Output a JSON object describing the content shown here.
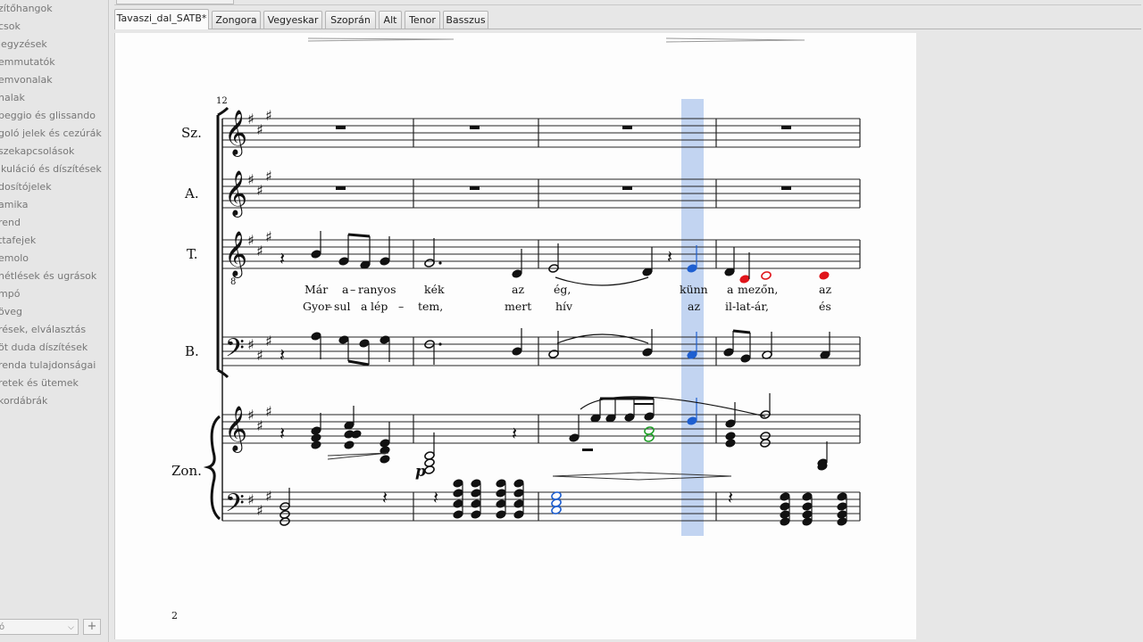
{
  "palette": {
    "items": [
      "zítőhangok",
      "csok",
      "jegyzések",
      "emmutatók",
      "emvonalak",
      "nalak",
      "peggio és glissando",
      "goló jelek és cezúrák",
      "szekapcsolások",
      "ikuláció és díszítések",
      "dosítójelek",
      "amika",
      "rend",
      "ttafejek",
      "emolo",
      "nétlések és ugrások",
      "mpó",
      "öveg",
      "rések, elválasztás",
      "öt duda díszítések",
      "renda tulajdonságai",
      "retek és ütemek",
      "kordábrák"
    ],
    "selector_value": "ó",
    "selector_arrow": "⌵",
    "add_label": "+"
  },
  "tabs": [
    "Tavaszi_dal_SATB*",
    "Zongora",
    "Vegyeskar",
    "Szoprán",
    "Alt",
    "Tenor",
    "Basszus"
  ],
  "score": {
    "measure_number": "12",
    "page_number": "2",
    "staff_names": [
      "Sz.",
      "A.",
      "T.",
      "B.",
      "Zon."
    ],
    "dynamic": "p",
    "tenor_octave_mark": "8",
    "lyrics_verse1": [
      "Már",
      "a",
      "–",
      "ranyos",
      "kék",
      "az",
      "ég,",
      "künn",
      "a",
      "mezőn,",
      "az"
    ],
    "lyrics_verse2": [
      "Gyor",
      "–",
      "sul",
      "a",
      "lép",
      "–",
      "tem,",
      "mert",
      "hív",
      "az",
      "il-lat-ár,",
      "és"
    ],
    "colors": {
      "selection": "#b7cdee",
      "selected_note": "#1e5fd0",
      "red_note": "#e0151b",
      "green_note": "#22a02a",
      "ink": "#111111"
    }
  }
}
